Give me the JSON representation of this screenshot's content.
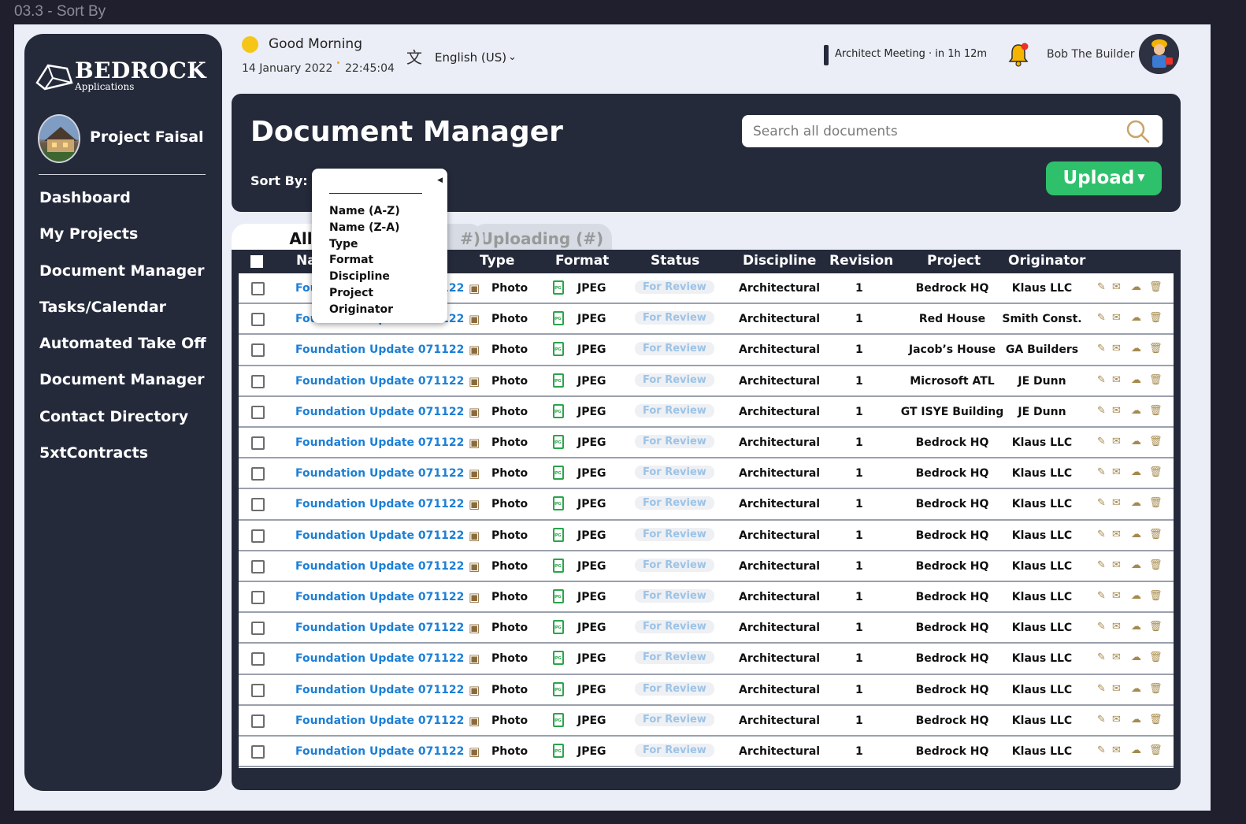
{
  "frame_label": "03.3 - Sort By",
  "brand": {
    "name": "BEDROCK",
    "sub": "Applications"
  },
  "project": {
    "name": "Project Faisal"
  },
  "nav": [
    "Dashboard",
    "My Projects",
    "Document Manager",
    "Tasks/Calendar",
    "Automated Take Off",
    "Document Manager",
    "Contact Directory",
    "5xtContracts"
  ],
  "header": {
    "greeting": "Good Morning",
    "date": "14 January 2022",
    "time": "22:45:04",
    "language": "English (US)",
    "language_icon": "translate-icon",
    "meeting": "Architect Meeting · in 1h 12m",
    "user": "Bob The Builder"
  },
  "doc_manager": {
    "title": "Document Manager",
    "search_placeholder": "Search all documents",
    "sort_label": "Sort By:",
    "upload_label": "Upload"
  },
  "tabs": {
    "all": "All",
    "review_suffix": "#)",
    "uploading": "Uploading (#)"
  },
  "sort_menu": {
    "current_value": "",
    "options": [
      "Name (A-Z)",
      "Name (Z-A)",
      "Type",
      "Format",
      "Discipline",
      "Project",
      "Originator"
    ]
  },
  "columns": {
    "name": "Na",
    "type": "Type",
    "format": "Format",
    "status": "Status",
    "discipline": "Discipline",
    "revision": "Revision",
    "project": "Project",
    "originator": "Originator"
  },
  "colors": {
    "sidebar_bg": "#252a3b",
    "accent_green": "#2fc06b",
    "link_blue": "#1c7fd6",
    "status_text": "#9cc3e6",
    "action_gold": "#a58a4e"
  },
  "rows": [
    {
      "name": "Foundation Update 071122",
      "type": "Photo",
      "format": "JPEG",
      "status": "For Review",
      "discipline": "Architectural",
      "revision": "1",
      "project": "Bedrock HQ",
      "originator": "Klaus  LLC"
    },
    {
      "name": "Foundation Update 071122",
      "type": "Photo",
      "format": "JPEG",
      "status": "For Review",
      "discipline": "Architectural",
      "revision": "1",
      "project": "Red House",
      "originator": "Smith Const."
    },
    {
      "name": "Foundation Update 071122",
      "type": "Photo",
      "format": "JPEG",
      "status": "For Review",
      "discipline": "Architectural",
      "revision": "1",
      "project": "Jacob’s House",
      "originator": "GA Builders"
    },
    {
      "name": "Foundation Update 071122",
      "type": "Photo",
      "format": "JPEG",
      "status": "For Review",
      "discipline": "Architectural",
      "revision": "1",
      "project": "Microsoft ATL",
      "originator": "JE Dunn"
    },
    {
      "name": "Foundation Update 071122",
      "type": "Photo",
      "format": "JPEG",
      "status": "For Review",
      "discipline": "Architectural",
      "revision": "1",
      "project": "GT ISYE Building",
      "originator": "JE Dunn"
    },
    {
      "name": "Foundation Update 071122",
      "type": "Photo",
      "format": "JPEG",
      "status": "For Review",
      "discipline": "Architectural",
      "revision": "1",
      "project": "Bedrock HQ",
      "originator": "Klaus  LLC"
    },
    {
      "name": "Foundation Update 071122",
      "type": "Photo",
      "format": "JPEG",
      "status": "For Review",
      "discipline": "Architectural",
      "revision": "1",
      "project": "Bedrock HQ",
      "originator": "Klaus  LLC"
    },
    {
      "name": "Foundation Update 071122",
      "type": "Photo",
      "format": "JPEG",
      "status": "For Review",
      "discipline": "Architectural",
      "revision": "1",
      "project": "Bedrock HQ",
      "originator": "Klaus  LLC"
    },
    {
      "name": "Foundation Update 071122",
      "type": "Photo",
      "format": "JPEG",
      "status": "For Review",
      "discipline": "Architectural",
      "revision": "1",
      "project": "Bedrock HQ",
      "originator": "Klaus  LLC"
    },
    {
      "name": "Foundation Update 071122",
      "type": "Photo",
      "format": "JPEG",
      "status": "For Review",
      "discipline": "Architectural",
      "revision": "1",
      "project": "Bedrock HQ",
      "originator": "Klaus  LLC"
    },
    {
      "name": "Foundation Update 071122",
      "type": "Photo",
      "format": "JPEG",
      "status": "For Review",
      "discipline": "Architectural",
      "revision": "1",
      "project": "Bedrock HQ",
      "originator": "Klaus  LLC"
    },
    {
      "name": "Foundation Update 071122",
      "type": "Photo",
      "format": "JPEG",
      "status": "For Review",
      "discipline": "Architectural",
      "revision": "1",
      "project": "Bedrock HQ",
      "originator": "Klaus  LLC"
    },
    {
      "name": "Foundation Update 071122",
      "type": "Photo",
      "format": "JPEG",
      "status": "For Review",
      "discipline": "Architectural",
      "revision": "1",
      "project": "Bedrock HQ",
      "originator": "Klaus  LLC"
    },
    {
      "name": "Foundation Update 071122",
      "type": "Photo",
      "format": "JPEG",
      "status": "For Review",
      "discipline": "Architectural",
      "revision": "1",
      "project": "Bedrock HQ",
      "originator": "Klaus  LLC"
    },
    {
      "name": "Foundation Update 071122",
      "type": "Photo",
      "format": "JPEG",
      "status": "For Review",
      "discipline": "Architectural",
      "revision": "1",
      "project": "Bedrock HQ",
      "originator": "Klaus  LLC"
    },
    {
      "name": "Foundation Update 071122",
      "type": "Photo",
      "format": "JPEG",
      "status": "For Review",
      "discipline": "Architectural",
      "revision": "1",
      "project": "Bedrock HQ",
      "originator": "Klaus  LLC"
    }
  ]
}
